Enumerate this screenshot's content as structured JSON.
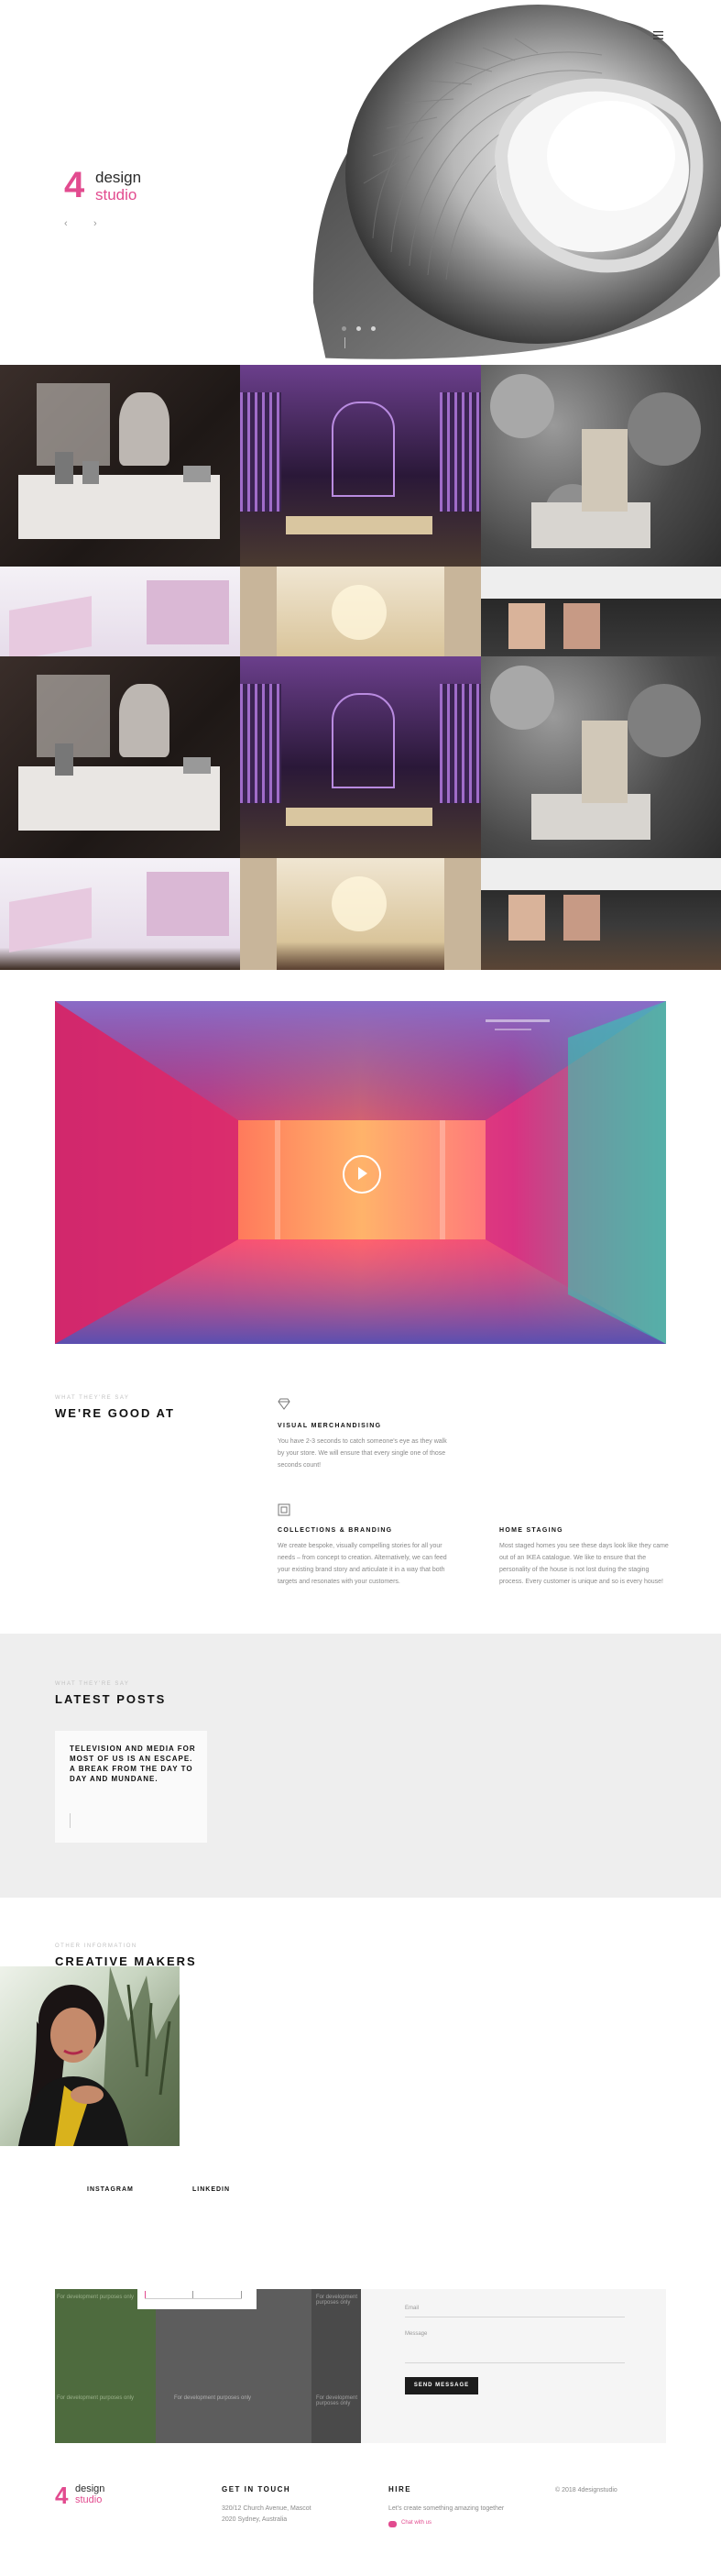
{
  "brand": {
    "mark": "4",
    "line1": "design",
    "line2": "studio"
  },
  "hero": {
    "slides_count": 3
  },
  "video": {
    "play_label": "Play video"
  },
  "services": {
    "eyebrow": "WHAT THEY'RE SAY",
    "heading": "WE'RE GOOD AT",
    "items": [
      {
        "title": "VISUAL MERCHANDISING",
        "body": "You have 2-3 seconds to catch someone's eye as they walk by your store. We will ensure that every single one of those seconds count!"
      },
      {
        "title": "COLLECTIONS & BRANDING",
        "body": "We create bespoke, visually compelling stories for all your needs – from concept to creation. Alternatively, we can feed your existing brand story and articulate it in a way that both targets and resonates with your customers."
      },
      {
        "title": "HOME STAGING",
        "body": "Most staged homes you see these days look like they came out of an IKEA catalogue. We like to ensure that the personality of the house is not lost during the staging process. Every customer is unique and so is every house!"
      }
    ]
  },
  "posts": {
    "eyebrow": "WHAT THEY'RE SAY",
    "heading": "LATEST POSTS",
    "card_text": "TELEVISION AND MEDIA FOR MOST OF US IS AN ESCAPE. A BREAK FROM THE DAY TO DAY AND MUNDANE."
  },
  "team": {
    "eyebrow": "OTHER INFORMATION",
    "heading": "CREATIVE MAKERS",
    "links": [
      "INSTAGRAM",
      "LINKEDIN"
    ]
  },
  "map": {
    "watermark": "For development purposes only"
  },
  "form": {
    "email_label": "Email",
    "message_label": "Message",
    "submit": "SEND MESSAGE"
  },
  "footer": {
    "col1_title": "GET IN TOUCH",
    "col1_text": "320/12 Church Avenue, Mascot 2020 Sydney, Australia",
    "col2_title": "HIRE",
    "col2_text": "Let's create something amazing together",
    "col2_chat": "Chat with us",
    "copyright": "© 2018 4designstudio"
  },
  "colors": {
    "accent": "#e24b8f",
    "dark_button": "#1c1c1c",
    "section_bg": "#eeeeee"
  }
}
